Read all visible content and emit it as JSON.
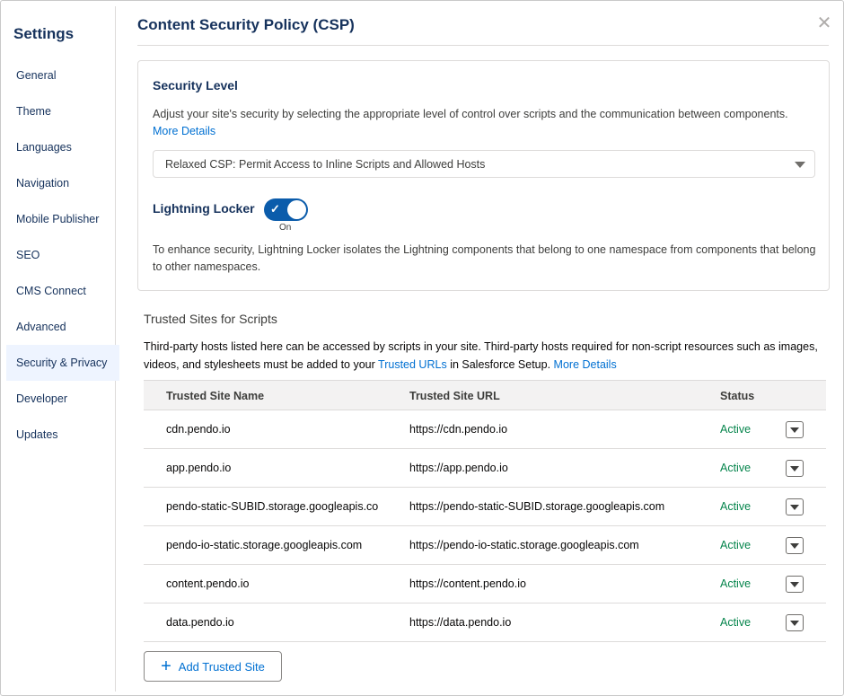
{
  "sidebar": {
    "title": "Settings",
    "items": [
      {
        "label": "General"
      },
      {
        "label": "Theme"
      },
      {
        "label": "Languages"
      },
      {
        "label": "Navigation"
      },
      {
        "label": "Mobile Publisher"
      },
      {
        "label": "SEO"
      },
      {
        "label": "CMS Connect"
      },
      {
        "label": "Advanced"
      },
      {
        "label": "Security & Privacy",
        "active": true
      },
      {
        "label": "Developer"
      },
      {
        "label": "Updates"
      }
    ]
  },
  "header": {
    "title": "Content Security Policy (CSP)",
    "close_icon": "close-icon"
  },
  "security_level": {
    "heading": "Security Level",
    "description": "Adjust your site's security by selecting the appropriate level of control over scripts and the communication between components.",
    "more_details": "More Details",
    "selected_option": "Relaxed CSP: Permit Access to Inline Scripts and Allowed Hosts",
    "locker_label": "Lightning Locker",
    "locker_state": "On",
    "locker_description": "To enhance security, Lightning Locker isolates the Lightning components that belong to one namespace from components that belong to other namespaces."
  },
  "trusted_sites": {
    "heading": "Trusted Sites for Scripts",
    "description_start": "Third-party hosts listed here can be accessed by scripts in your site. Third-party hosts required for non-script resources such as images, videos, and stylesheets must be added to your",
    "trusted_urls_link": "Trusted URLs",
    "description_mid": "in Salesforce Setup.",
    "more_details": "More Details",
    "columns": [
      "Trusted Site Name",
      "Trusted Site URL",
      "Status"
    ],
    "rows": [
      {
        "name": "cdn.pendo.io",
        "url": "https://cdn.pendo.io",
        "status": "Active"
      },
      {
        "name": "app.pendo.io",
        "url": "https://app.pendo.io",
        "status": "Active"
      },
      {
        "name": "pendo-static-SUBID.storage.googleapis.co",
        "url": "https://pendo-static-SUBID.storage.googleapis.com",
        "status": "Active"
      },
      {
        "name": "pendo-io-static.storage.googleapis.com",
        "url": "https://pendo-io-static.storage.googleapis.com",
        "status": "Active"
      },
      {
        "name": "content.pendo.io",
        "url": "https://content.pendo.io",
        "status": "Active"
      },
      {
        "name": "data.pendo.io",
        "url": "https://data.pendo.io",
        "status": "Active"
      }
    ],
    "add_button": "Add Trusted Site"
  },
  "colors": {
    "accent": "#0070d2",
    "toggle_on": "#0b5cab",
    "status_active": "#04844b",
    "heading": "#16325c"
  }
}
